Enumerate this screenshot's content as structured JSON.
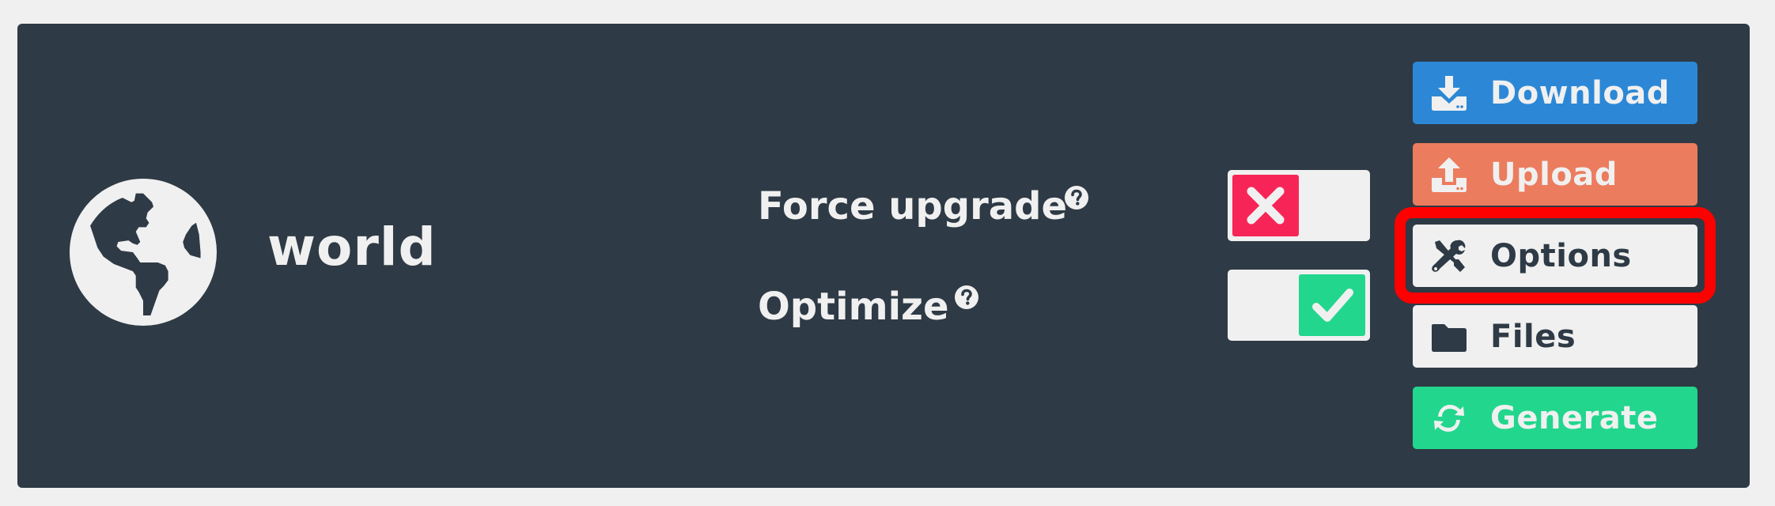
{
  "item": {
    "name": "world",
    "icon": "globe-icon"
  },
  "options": [
    {
      "label": "Force upgrade",
      "help_icon": "question-circle-icon",
      "enabled": false,
      "state_icon": "x-icon"
    },
    {
      "label": "Optimize",
      "help_icon": "question-circle-icon",
      "enabled": true,
      "state_icon": "check-icon"
    }
  ],
  "actions": [
    {
      "label": "Download",
      "icon": "download-icon",
      "color": "#2c88d6"
    },
    {
      "label": "Upload",
      "icon": "upload-icon",
      "color": "#ec7c5e"
    },
    {
      "label": "Options",
      "icon": "tools-icon",
      "color": "#f0f0f0",
      "highlighted": true
    },
    {
      "label": "Files",
      "icon": "folder-icon",
      "color": "#f0f0f0"
    },
    {
      "label": "Generate",
      "icon": "refresh-icon",
      "color": "#22d68e"
    }
  ],
  "colors": {
    "panel_bg": "#2e3a45",
    "page_bg": "#f0f0f0",
    "toggle_off": "#f72557",
    "toggle_on": "#22d68e",
    "highlight": "#ff0000"
  }
}
